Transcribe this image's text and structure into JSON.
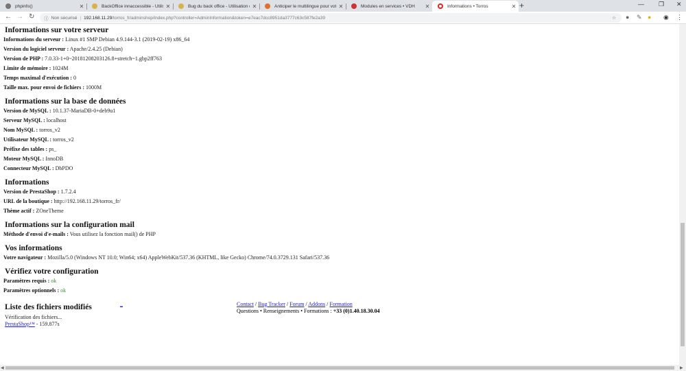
{
  "browser": {
    "tabs": [
      {
        "title": "phpinfo()",
        "icon": "globe-icon",
        "color": "#777777"
      },
      {
        "title": "BackOffice innaccessible - Utilisa",
        "icon": "prestashop-icon",
        "color": "#d8b24a"
      },
      {
        "title": "Bug du back office - Utilisation d",
        "icon": "prestashop-icon",
        "color": "#d8b24a"
      },
      {
        "title": "Anticiper le multilingue pour vot",
        "icon": "site-icon",
        "color": "#e07030"
      },
      {
        "title": "Modules en services • VDH",
        "icon": "vdh-icon",
        "color": "#cc3333"
      },
      {
        "title": "Informations • Torros",
        "icon": "torros-icon",
        "color": "#dd2222"
      }
    ],
    "security_label": "Non sécurisé",
    "url_host": "192.168.11.29",
    "url_path": "/torros_fr/adminshop/index.php?controller=AdminInformation&token=e7eac7dcc8951da3777c63c587fe2a39"
  },
  "sections": [
    {
      "title": "Informations sur votre serveur",
      "rows": [
        {
          "label": "Informations du serveur :",
          "value": "Linux #1 SMP Debian 4.9.144-3.1 (2019-02-19) x86_64"
        },
        {
          "label": "Version du logiciel serveur :",
          "value": "Apache/2.4.25 (Debian)"
        },
        {
          "label": "Version de PHP :",
          "value": "7.0.33-1+0~20181208203126.8+stretch~1.gbp2ff763"
        },
        {
          "label": "Limite de mémoire :",
          "value": "1024M"
        },
        {
          "label": "Temps maximal d'exécution :",
          "value": "0"
        },
        {
          "label": "Taille max. pour envoi de fichiers :",
          "value": "1000M"
        }
      ]
    },
    {
      "title": "Informations sur la base de données",
      "rows": [
        {
          "label": "Version de MySQL :",
          "value": "10.1.37-MariaDB-0+deb9u1"
        },
        {
          "label": "Serveur MySQL :",
          "value": "localhost"
        },
        {
          "label": "Nom MySQL :",
          "value": "torros_v2"
        },
        {
          "label": "Utilisateur MySQL :",
          "value": "torros_v2"
        },
        {
          "label": "Préfixe des tables :",
          "value": "ps_"
        },
        {
          "label": "Moteur MySQL :",
          "value": "InnoDB"
        },
        {
          "label": "Connecteur MySQL :",
          "value": "DbPDO"
        }
      ]
    },
    {
      "title": "Informations",
      "rows": [
        {
          "label": "Version de PrestaShop :",
          "value": "1.7.2.4"
        },
        {
          "label": "URL de la boutique :",
          "value": "http://192.168.11.29/torros_fr/"
        },
        {
          "label": "Thème actif :",
          "value": "ZOneTheme"
        }
      ]
    },
    {
      "title": "Informations sur la configuration mail",
      "rows": [
        {
          "label": "Méthode d'envoi d'e-mails :",
          "value": "Vous utilisez la fonction mail() de PHP"
        }
      ]
    },
    {
      "title": "Vos informations",
      "rows": [
        {
          "label": "Votre navigateur :",
          "value": "Mozilla/5.0 (Windows NT 10.0; Win64; x64) AppleWebKit/537.36 (KHTML, like Gecko) Chrome/74.0.3729.131 Safari/537.36"
        }
      ]
    },
    {
      "title": "Vérifiez votre configuration",
      "rows": [
        {
          "label": "Paramètres requis :",
          "value": "ok",
          "ok": true
        },
        {
          "label": "Paramètres optionnels :",
          "value": "ok",
          "ok": true
        }
      ]
    }
  ],
  "files": {
    "title": "Liste des fichiers modifiés",
    "status": "Vérification des fichiers...",
    "brand_link": "PrestaShop™",
    "timing": " -  159.877s",
    "dash_link": "_"
  },
  "footer": {
    "links": [
      "Contact",
      "Bug Tracker",
      "Forum",
      "Addons",
      "Formation"
    ],
    "questions": "Questions • Renseignements • Formations : ",
    "phone": "+33 (0)1.40.18.30.04"
  }
}
